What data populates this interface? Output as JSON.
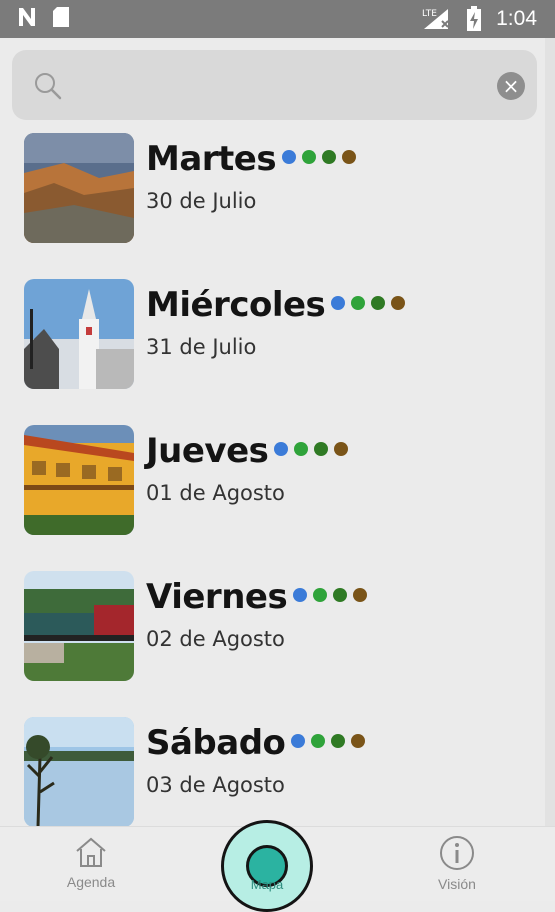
{
  "status_bar": {
    "time": "1:04",
    "network": "LTE",
    "icons": [
      "n-logo-icon",
      "sd-card-icon",
      "signal-icon",
      "battery-charging-icon"
    ]
  },
  "search": {
    "placeholder": "",
    "clear_icon": "clear-icon",
    "search_icon": "search-icon"
  },
  "days": [
    {
      "day": "Martes",
      "date": "30 de Julio",
      "dots": [
        "#3b7bd8",
        "#2fa33a",
        "#2f7a24",
        "#7a5418"
      ]
    },
    {
      "day": "Miércoles",
      "date": "31 de Julio",
      "dots": [
        "#3b7bd8",
        "#2fa33a",
        "#2f7a24",
        "#7a5418"
      ]
    },
    {
      "day": "Jueves",
      "date": "01 de Agosto",
      "dots": [
        "#3b7bd8",
        "#2fa33a",
        "#2f7a24",
        "#7a5418"
      ]
    },
    {
      "day": "Viernes",
      "date": "02 de Agosto",
      "dots": [
        "#3b7bd8",
        "#2fa33a",
        "#2f7a24",
        "#7a5418"
      ]
    },
    {
      "day": "Sábado",
      "date": "03 de Agosto",
      "dots": [
        "#3b7bd8",
        "#2fa33a",
        "#2f7a24",
        "#7a5418"
      ]
    }
  ],
  "bottom_nav": {
    "agenda": {
      "label": "Agenda",
      "icon": "home-icon"
    },
    "center": {
      "label": "Mapa",
      "icon": "magnifier-icon"
    },
    "vision": {
      "label": "Visión",
      "icon": "info-icon"
    }
  }
}
